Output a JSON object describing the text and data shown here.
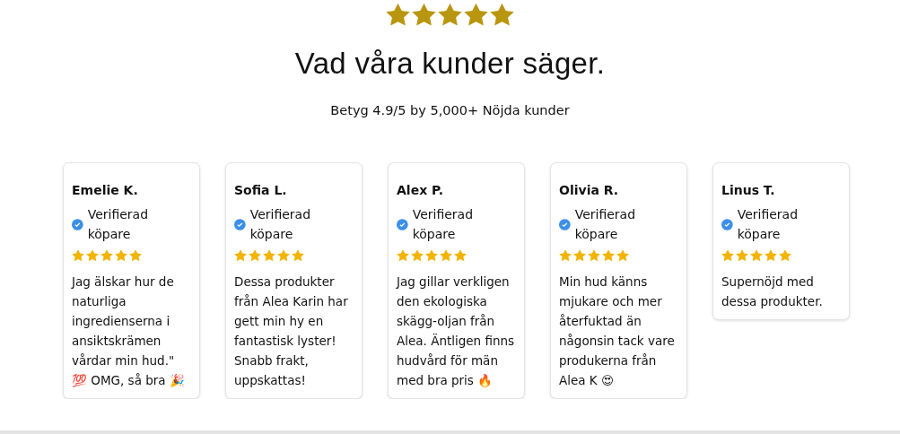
{
  "rating": {
    "stars": 5
  },
  "heading": "Vad våra kunder säger.",
  "subtitle": "Betyg 4.9/5 by 5,000+ Nöjda kunder",
  "reviews": [
    {
      "name": "Emelie K.",
      "verified": true,
      "badge": "Verifierad köpare",
      "stars": 5,
      "text": "Jag älskar hur de naturliga ingredienserna i ansiktskrämen vårdar min hud.\" 💯 OMG, så bra 🎉"
    },
    {
      "name": "Sofia L.",
      "verified": true,
      "badge": "Verifierad köpare",
      "stars": 5,
      "text": "Dessa produkter från Alea Karin har gett min hy en fantastisk lyster! Snabb frakt, uppskattas!"
    },
    {
      "name": "Alex P.",
      "verified": true,
      "badge": "Verifierad köpare",
      "stars": 5,
      "text": "Jag gillar verkligen den ekologiska skägg-oljan från Alea. Äntligen finns hudvård för män med bra pris 🔥"
    },
    {
      "name": "Olivia R.",
      "verified": true,
      "badge": "Verifierad köpare",
      "stars": 5,
      "text": "Min hud känns mjukare och mer återfuktad än någonsin tack vare produkerna från Alea K 😍"
    },
    {
      "name": "Linus T.",
      "verified": true,
      "badge": "Verifierad köpare",
      "stars": 5,
      "text": "Supernöjd med dessa produkter."
    }
  ]
}
